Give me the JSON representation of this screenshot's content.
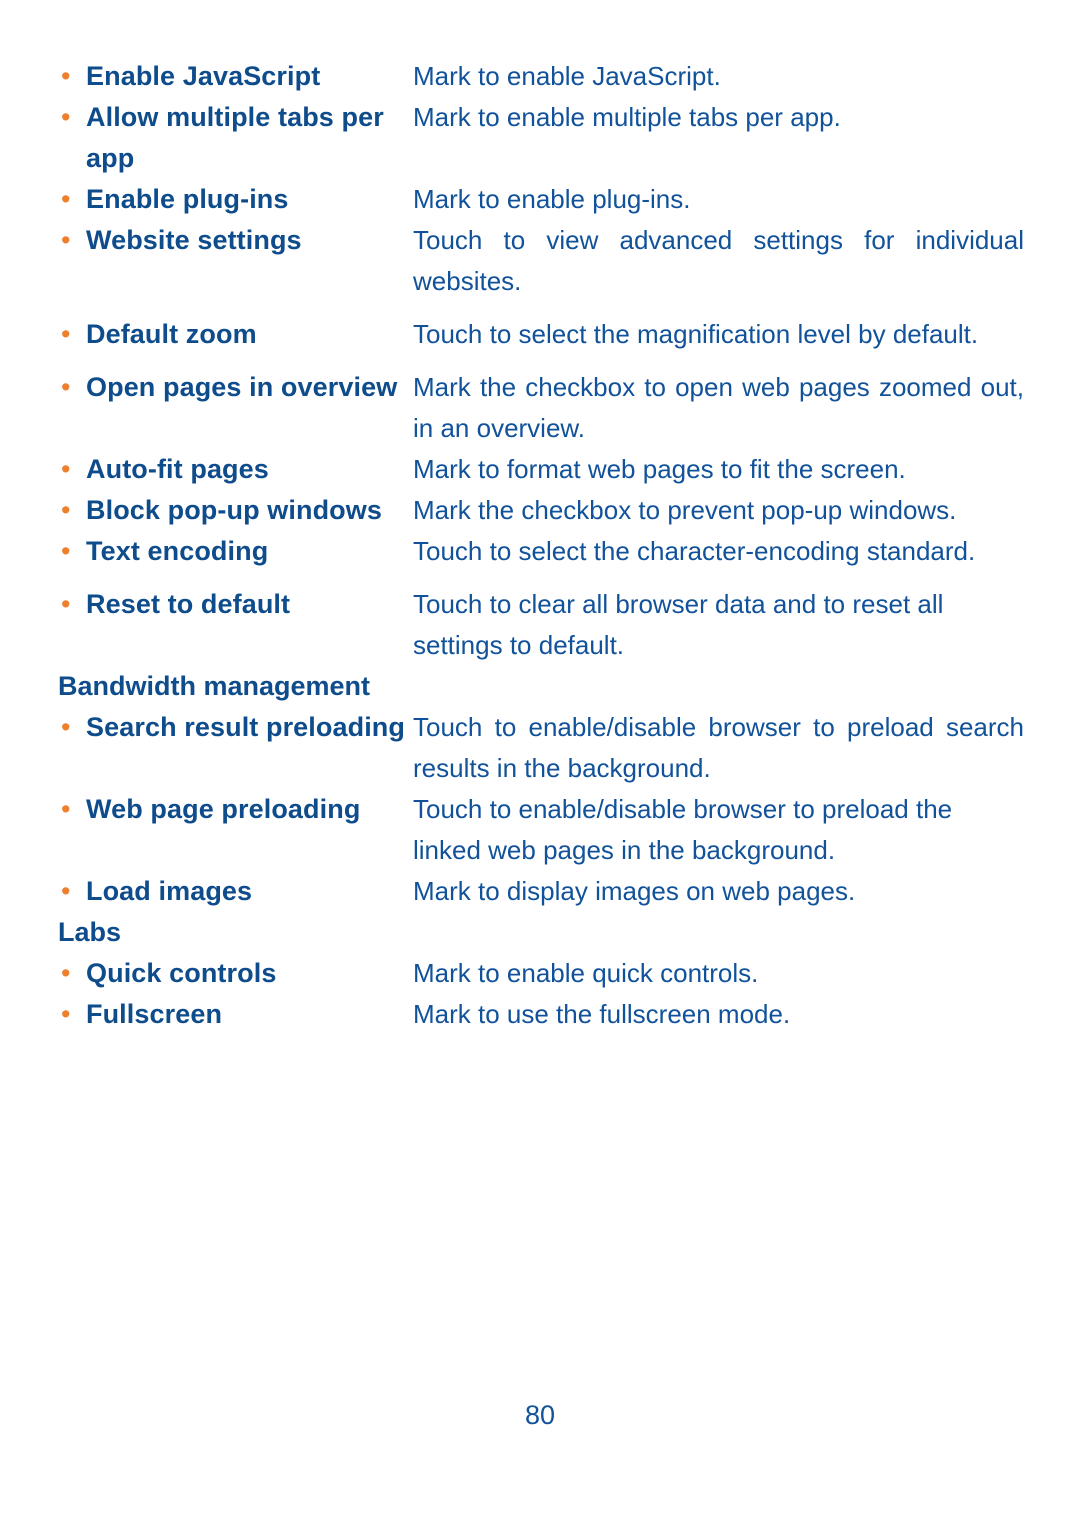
{
  "page": {
    "number": "80",
    "text_color": "#11529A",
    "term_color": "#0F4C8C",
    "bullet_color": "#EE7F2D",
    "background": "#FFFFFF"
  },
  "bullet_glyph": "•",
  "entries": [
    {
      "term": "Enable JavaScript",
      "description": "Mark to enable JavaScript.",
      "justified": false,
      "gap_after": "none"
    },
    {
      "term": "Allow multiple tabs per app",
      "description": "Mark to enable multiple tabs per app.",
      "justified": false,
      "gap_after": "none"
    },
    {
      "term": "Enable plug-ins",
      "description": "Mark to enable plug-ins.",
      "justified": false,
      "gap_after": "none"
    },
    {
      "term": "Website settings",
      "description": "Touch to view advanced settings for individual websites.",
      "justified": true,
      "gap_after": "small"
    },
    {
      "term": "Default zoom",
      "description": "Touch to select the magnification level by default.",
      "justified": true,
      "gap_after": "small"
    },
    {
      "term": "Open pages in overview",
      "description": "Mark the checkbox to open web pages zoomed out, in an overview.",
      "justified": true,
      "gap_after": "none"
    },
    {
      "term": "Auto-fit pages",
      "description": "Mark to format web pages to fit the screen.",
      "justified": false,
      "gap_after": "none"
    },
    {
      "term": "Block pop-up windows",
      "description": "Mark the checkbox to prevent pop-up windows.",
      "justified": true,
      "gap_after": "none"
    },
    {
      "term": "Text encoding",
      "description": "Touch to select the character-encoding standard.",
      "justified": true,
      "gap_after": "small"
    },
    {
      "term": "Reset to default",
      "description": "Touch to clear all browser data and to reset all settings to default.",
      "justified": false,
      "gap_after": "none"
    }
  ],
  "sections": [
    {
      "heading": "Bandwidth management",
      "entries": [
        {
          "term": "Search result preloading",
          "description": "Touch to enable/disable browser to preload search results in the background.",
          "justified": true,
          "gap_after": "none"
        },
        {
          "term": "Web page preloading",
          "description": "Touch to enable/disable browser to preload the linked web pages in the background.",
          "justified": false,
          "gap_after": "none"
        },
        {
          "term": "Load images",
          "description": "Mark to display images on web pages.",
          "justified": false,
          "gap_after": "none"
        }
      ]
    },
    {
      "heading": "Labs",
      "entries": [
        {
          "term": "Quick controls",
          "description": "Mark to enable quick controls.",
          "justified": false,
          "gap_after": "none"
        },
        {
          "term": "Fullscreen",
          "description": "Mark to use the fullscreen mode.",
          "justified": false,
          "gap_after": "none"
        }
      ]
    }
  ]
}
